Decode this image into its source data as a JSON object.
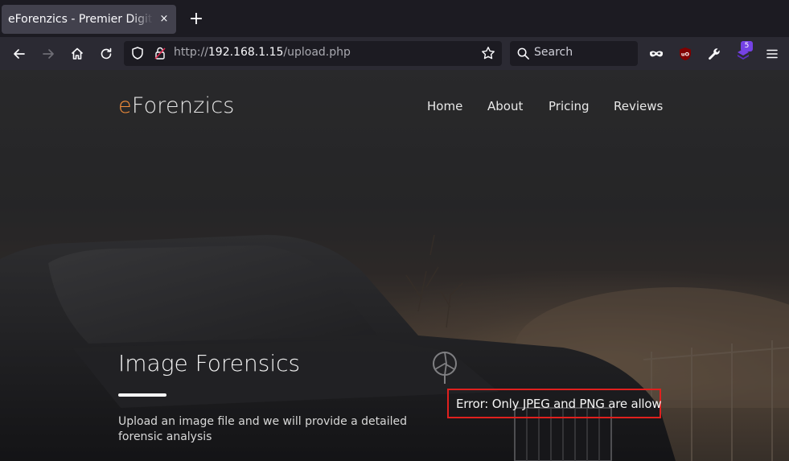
{
  "browser": {
    "tab_title": "eForenzics - Premier Digital Forensics",
    "tab_close": "×",
    "new_tab": "+",
    "url_prefix": "http://",
    "url_host": "192.168.1.15",
    "url_path": "/upload.php",
    "search_placeholder": "Search",
    "extension_badge": "5",
    "icons": [
      "back-icon",
      "forward-icon",
      "home-icon",
      "reload-icon",
      "shield-icon",
      "lock-icon",
      "star-icon",
      "search-icon",
      "mask-icon",
      "ublock-icon",
      "wrench-icon",
      "extension-icon",
      "menu-icon"
    ]
  },
  "site": {
    "brand_e": "e",
    "brand_rest": "Forenzics",
    "nav": [
      {
        "label": "Home"
      },
      {
        "label": "About"
      },
      {
        "label": "Pricing"
      },
      {
        "label": "Reviews"
      }
    ]
  },
  "hero": {
    "title": "Image Forensics",
    "subtitle": "Upload an image file and we will provide a detailed forensic analysis"
  },
  "upload": {
    "error_message": "Error: Only JPEG and PNG are allow"
  },
  "colors": {
    "brand_accent": "#f08c3a",
    "error_border": "#e0201e",
    "chrome_bg": "#1c1b22",
    "toolbar_bg": "#2b2a33"
  }
}
